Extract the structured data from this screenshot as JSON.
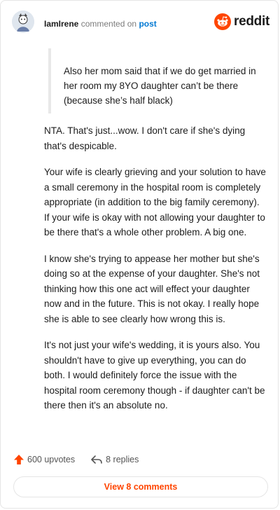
{
  "header": {
    "username": "IamIrene",
    "action": "commented on",
    "target": "post",
    "brand": "reddit",
    "brand_color": "#ff4500",
    "avatar_icon": "user-avatar-icon",
    "brand_icon": "reddit-snoo-icon"
  },
  "quote": {
    "text": "Also her mom said that if we do get married in her room my 8YO daughter can’t be there (because she’s half black)"
  },
  "comment": {
    "paragraphs": [
      "NTA. That's just...wow. I don't care if she's dying that's despicable.",
      "Your wife is clearly grieving and your solution to have a small ceremony in the hospital room is completely appropriate (in addition to the big family ceremony). If your wife is okay with not allowing your daughter to be there that's a whole other problem. A big one.",
      "I know she's trying to appease her mother but she's doing so at the expense of your daughter. She's not thinking how this one act will effect your daughter now and in the future. This is not okay. I really hope she is able to see clearly how wrong this is.",
      "It's not just your wife's wedding, it is yours also. You shouldn't have to give up everything, you can do both. I would definitely force the issue with the hospital room ceremony though - if daughter can't be there then it's an absolute no."
    ]
  },
  "stats": {
    "upvotes": "600 upvotes",
    "replies": "8 replies",
    "upvote_icon": "upvote-arrow-icon",
    "reply_icon": "reply-arrow-icon"
  },
  "cta": {
    "label": "View 8 comments"
  }
}
